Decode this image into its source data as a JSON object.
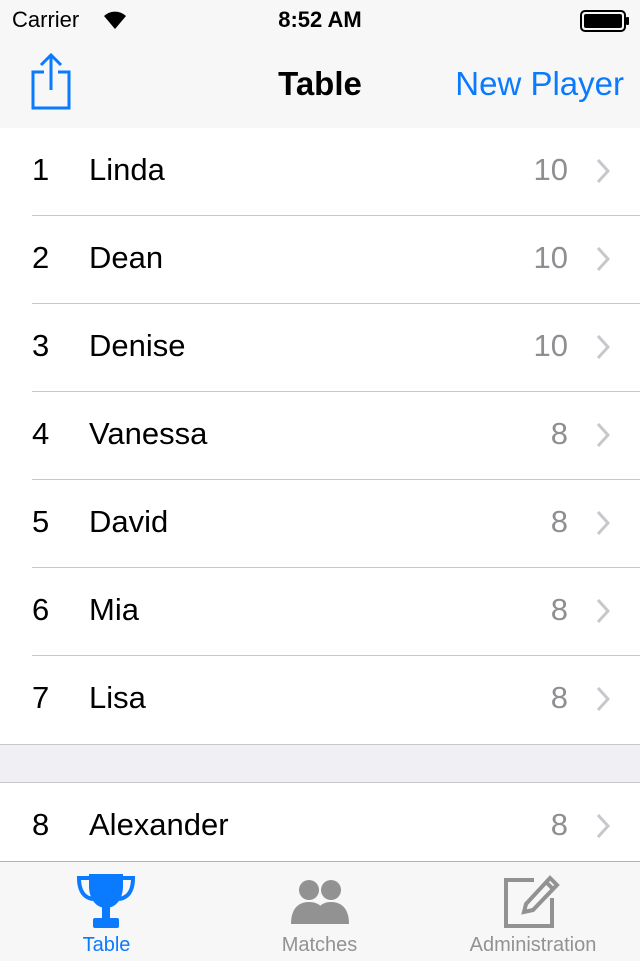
{
  "status": {
    "carrier": "Carrier",
    "time": "8:52 AM"
  },
  "nav": {
    "title": "Table",
    "right_button": "New Player",
    "share_icon": "share-icon"
  },
  "colors": {
    "accent": "#0a7aff",
    "secondary_text": "#8e8e93",
    "inactive_tab": "#929292"
  },
  "table": {
    "section1": [
      {
        "rank": "1",
        "name": "Linda",
        "score": "10"
      },
      {
        "rank": "2",
        "name": "Dean",
        "score": "10"
      },
      {
        "rank": "3",
        "name": "Denise",
        "score": "10"
      },
      {
        "rank": "4",
        "name": "Vanessa",
        "score": "8"
      },
      {
        "rank": "5",
        "name": "David",
        "score": "8"
      },
      {
        "rank": "6",
        "name": "Mia",
        "score": "8"
      },
      {
        "rank": "7",
        "name": "Lisa",
        "score": "8"
      }
    ],
    "section2": [
      {
        "rank": "8",
        "name": "Alexander",
        "score": "8"
      }
    ]
  },
  "tabs": [
    {
      "label": "Table",
      "icon": "trophy-icon",
      "active": true
    },
    {
      "label": "Matches",
      "icon": "people-icon",
      "active": false
    },
    {
      "label": "Administration",
      "icon": "edit-icon",
      "active": false
    }
  ]
}
